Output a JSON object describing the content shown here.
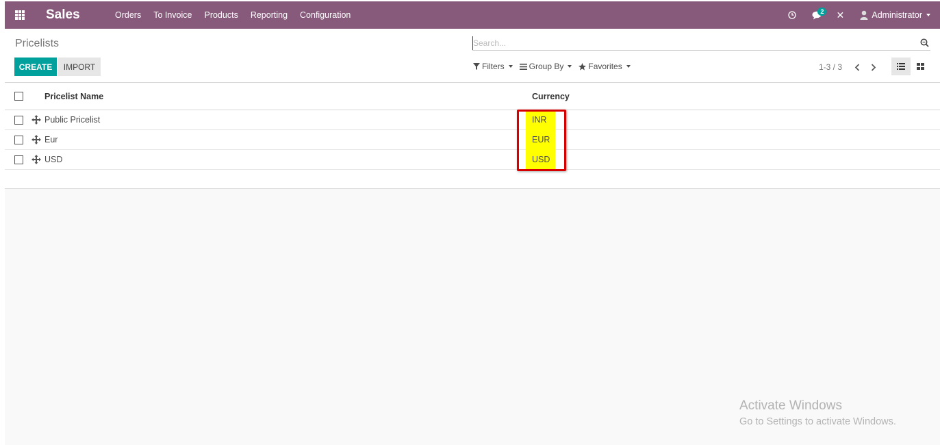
{
  "navbar": {
    "app_title": "Sales",
    "menu": [
      {
        "label": "Orders"
      },
      {
        "label": "To Invoice"
      },
      {
        "label": "Products"
      },
      {
        "label": "Reporting"
      },
      {
        "label": "Configuration"
      }
    ],
    "icons": {
      "apps": "grid-icon",
      "clock": "clock-icon",
      "chat": "chat-icon",
      "debug": "wrench-cross-icon",
      "user": "user-icon"
    },
    "chat_badge": "2",
    "debug_glyph": "✕",
    "user_name": "Administrator",
    "brand_color": "#875a7b"
  },
  "control_panel": {
    "breadcrumb": "Pricelists",
    "create_label": "CREATE",
    "import_label": "IMPORT",
    "search_placeholder": "Search...",
    "filters_label": "Filters",
    "groupby_label": "Group By",
    "favorites_label": "Favorites",
    "pager_value": "1-3 / 3",
    "accent_color": "#00a09d"
  },
  "list": {
    "columns": {
      "name": "Pricelist Name",
      "currency": "Currency"
    },
    "rows": [
      {
        "name": "Public Pricelist",
        "currency": "INR"
      },
      {
        "name": "Eur",
        "currency": "EUR"
      },
      {
        "name": "USD",
        "currency": "USD"
      }
    ]
  },
  "annotation": {
    "highlight_color": "#ffff00",
    "box_color": "#d60000"
  },
  "watermark": {
    "title": "Activate Windows",
    "subtitle": "Go to Settings to activate Windows."
  }
}
